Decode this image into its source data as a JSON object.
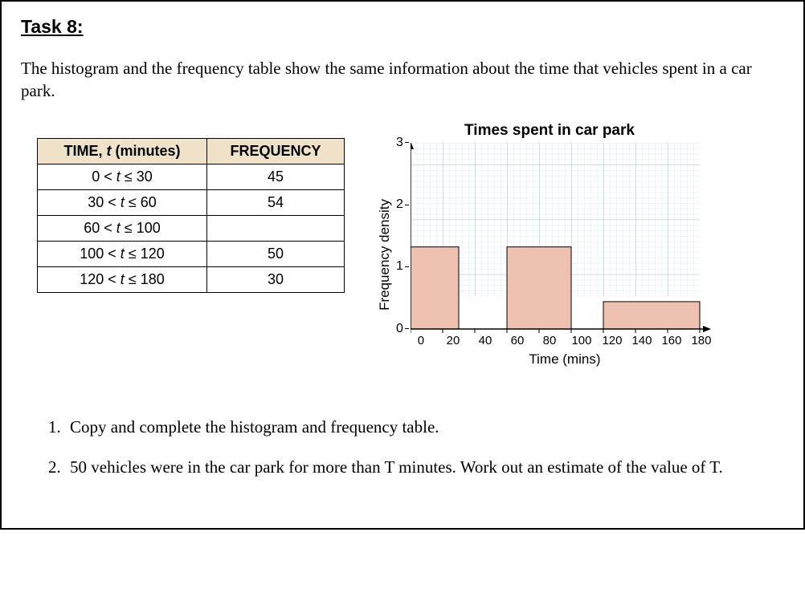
{
  "task_title": "Task 8:",
  "intro": "The histogram and the frequency table show the same information about the time that vehicles spent in a car park.",
  "table": {
    "headers": {
      "range": "TIME, t (minutes)",
      "freq": "FREQUENCY"
    },
    "rows": [
      {
        "range": "0 < t ≤ 30",
        "freq": "45"
      },
      {
        "range": "30 < t ≤ 60",
        "freq": "54"
      },
      {
        "range": "60 < t ≤ 100",
        "freq": ""
      },
      {
        "range": "100 < t ≤ 120",
        "freq": "50"
      },
      {
        "range": "120 < t ≤ 180",
        "freq": "30"
      }
    ]
  },
  "chart": {
    "title": "Times spent in car park",
    "xlabel": "Time (mins)",
    "ylabel": "Frequency density",
    "yticks": [
      "3",
      "2",
      "1",
      "0"
    ],
    "xticks": [
      "0",
      "20",
      "40",
      "60",
      "80",
      "100",
      "120",
      "140",
      "160",
      "180"
    ]
  },
  "chart_data": {
    "type": "bar",
    "title": "Times spent in car park",
    "xlabel": "Time (mins)",
    "ylabel": "Frequency density",
    "xlim": [
      0,
      180
    ],
    "ylim": [
      0,
      3.4
    ],
    "bars": [
      {
        "x_start": 0,
        "x_end": 30,
        "density": 1.5
      },
      {
        "x_start": 60,
        "x_end": 100,
        "density": 1.5
      },
      {
        "x_start": 120,
        "x_end": 180,
        "density": 0.5
      }
    ]
  },
  "questions": {
    "q1": "Copy and complete the histogram and frequency table.",
    "q2": "50 vehicles were in the car park for more than T minutes. Work out an estimate of the value of T."
  }
}
